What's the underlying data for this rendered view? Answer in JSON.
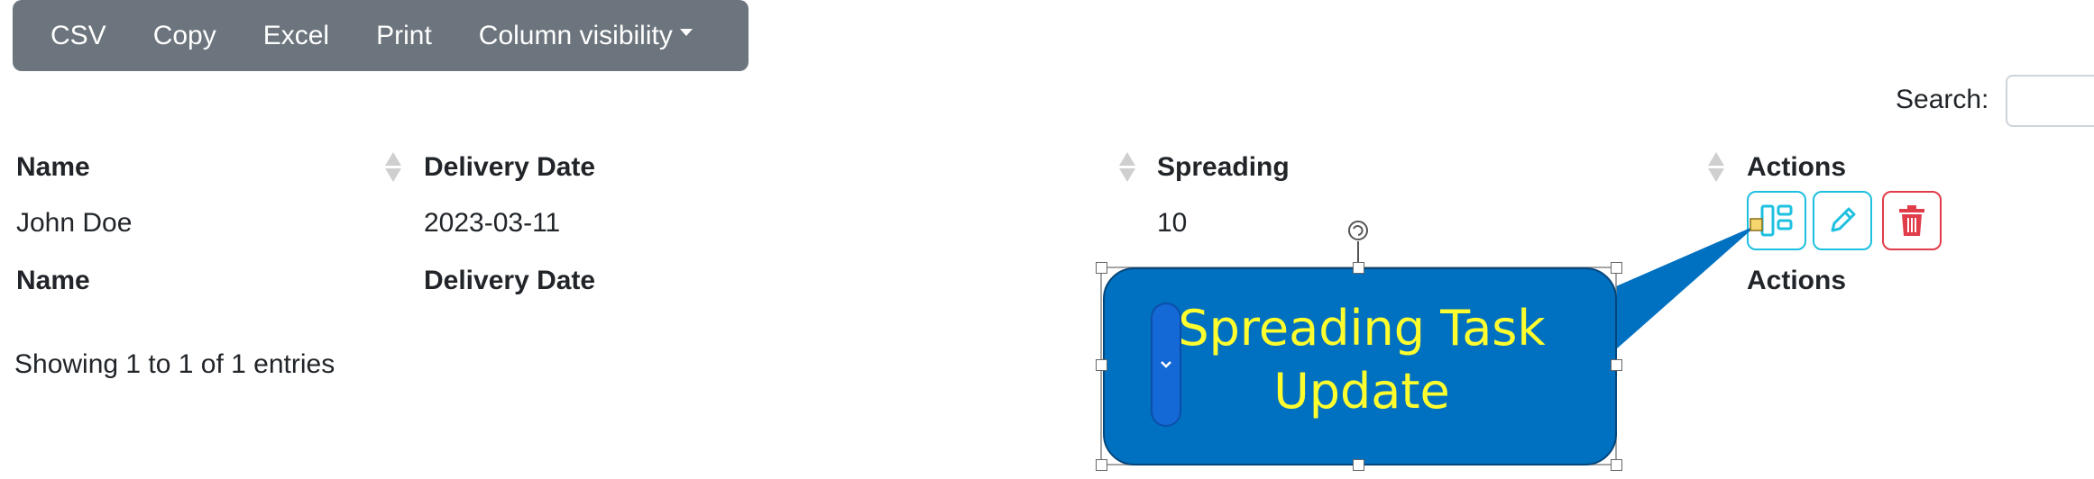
{
  "toolbar": {
    "buttons": [
      "CSV",
      "Copy",
      "Excel",
      "Print",
      "Column visibility"
    ]
  },
  "search": {
    "label": "Search:",
    "value": ""
  },
  "table": {
    "headers": [
      "Name",
      "Delivery Date",
      "Spreading",
      "Actions"
    ],
    "rows": [
      {
        "name": "John Doe",
        "delivery_date": "2023-03-11",
        "spreading": "10"
      }
    ],
    "footer_headers": [
      "Name",
      "Delivery Date",
      "Actions"
    ]
  },
  "info": "Showing 1 to 1 of 1 entries",
  "callout": {
    "text_line1": "Spreading Task",
    "text_line2": "Update",
    "fill_color": "#0070c0",
    "text_color": "#ffff2e"
  },
  "actions": {
    "icons": [
      "layout-icon",
      "pencil-icon",
      "trash-icon"
    ],
    "info_color": "#1ec0e0",
    "danger_color": "#e03c4a"
  }
}
